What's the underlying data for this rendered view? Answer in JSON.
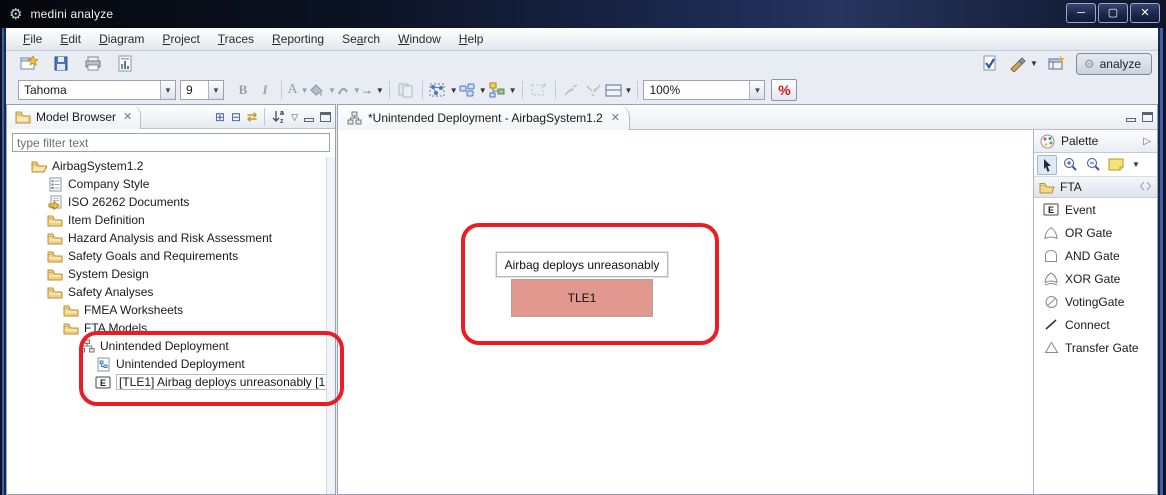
{
  "window": {
    "title": "medini analyze",
    "minimize_glyph": "─",
    "maximize_glyph": "▢",
    "close_glyph": "✕"
  },
  "menu_items": [
    {
      "label": "File",
      "mnemonic": 0
    },
    {
      "label": "Edit",
      "mnemonic": 0
    },
    {
      "label": "Diagram",
      "mnemonic": 0
    },
    {
      "label": "Project",
      "mnemonic": 0
    },
    {
      "label": "Traces",
      "mnemonic": 0
    },
    {
      "label": "Reporting",
      "mnemonic": 0
    },
    {
      "label": "Search",
      "mnemonic": 2
    },
    {
      "label": "Window",
      "mnemonic": 0
    },
    {
      "label": "Help",
      "mnemonic": 0
    }
  ],
  "toolbar": {
    "font_name": "Tahoma",
    "font_size": "9",
    "bold_label": "B",
    "italic_label": "I",
    "font_color_label": "A",
    "arrow_label": "→",
    "zoom_level": "100%",
    "percent_label": "%",
    "analyze_label": "analyze"
  },
  "model_browser": {
    "title": "Model Browser",
    "close_glyph": "✕",
    "filter_text": "type filter text",
    "tree": [
      {
        "label": "AirbagSystem1.2",
        "level": 0,
        "icon": "folder-open"
      },
      {
        "label": "Company Style",
        "level": 1,
        "icon": "style"
      },
      {
        "label": "ISO 26262 Documents",
        "level": 1,
        "icon": "doc-arrow"
      },
      {
        "label": "Item Definition",
        "level": 1,
        "icon": "folder"
      },
      {
        "label": "Hazard Analysis and Risk Assessment",
        "level": 1,
        "icon": "folder"
      },
      {
        "label": "Safety Goals and Requirements",
        "level": 1,
        "icon": "folder"
      },
      {
        "label": "System Design",
        "level": 1,
        "icon": "folder"
      },
      {
        "label": "Safety Analyses",
        "level": 1,
        "icon": "folder"
      },
      {
        "label": "FMEA Worksheets",
        "level": 2,
        "icon": "folder"
      },
      {
        "label": "FTA Models",
        "level": 2,
        "icon": "folder"
      },
      {
        "label": "Unintended Deployment",
        "level": 3,
        "icon": "fta"
      },
      {
        "label": "Unintended Deployment",
        "level": 4,
        "icon": "diagram"
      },
      {
        "label": "[TLE1] Airbag deploys unreasonably [1",
        "level": 4,
        "icon": "event",
        "boxed": true
      }
    ]
  },
  "editor": {
    "tab_title": "*Unintended Deployment - AirbagSystem1.2",
    "close_glyph": "✕",
    "node_label": "Airbag deploys unreasonably",
    "node_id": "TLE1",
    "node_fill": "#e2978f"
  },
  "palette": {
    "title": "Palette",
    "expand_glyph": "▷",
    "drawer_label": "FTA",
    "items": [
      {
        "label": "Event",
        "icon": "event"
      },
      {
        "label": "OR Gate",
        "icon": "or-gate"
      },
      {
        "label": "AND Gate",
        "icon": "and-gate"
      },
      {
        "label": "XOR Gate",
        "icon": "xor-gate"
      },
      {
        "label": "VotingGate",
        "icon": "voting-gate"
      },
      {
        "label": "Connect",
        "icon": "connect"
      },
      {
        "label": "Transfer Gate",
        "icon": "transfer-gate"
      }
    ]
  },
  "annotations": {
    "highlight_color": "#ed1c24",
    "targets": [
      "fta-tree-items",
      "top-level-event-node"
    ]
  }
}
